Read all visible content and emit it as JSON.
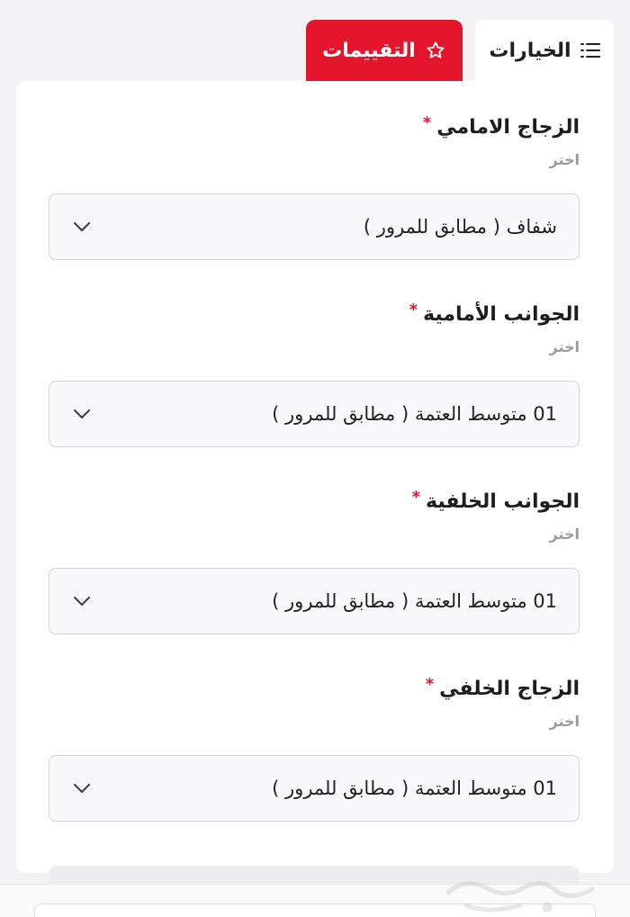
{
  "tabs": {
    "options": {
      "label": "الخيارات",
      "icon": "list-icon"
    },
    "reviews": {
      "label": "التقييمات",
      "icon": "star-icon"
    }
  },
  "fields": [
    {
      "label": "الزجاج الامامي",
      "required": "*",
      "hint": "اختر",
      "value": "شفاف ( مطابق للمرور )"
    },
    {
      "label": "الجوانب الأمامية",
      "required": "*",
      "hint": "اختر",
      "value": "01 متوسط العتمة ( مطابق للمرور )"
    },
    {
      "label": "الجوانب الخلفية",
      "required": "*",
      "hint": "اختر",
      "value": "01 متوسط العتمة ( مطابق للمرور )"
    },
    {
      "label": "الزجاج الخلفي",
      "required": "*",
      "hint": "اختر",
      "value": "01 متوسط العتمة ( مطابق للمرور )"
    }
  ],
  "colors": {
    "accent": "#e3162e",
    "background": "#f3f3f5",
    "card": "#ffffff",
    "select_border": "#d5d5d8"
  },
  "watermark": {
    "icon": "haraj-logo-watermark"
  }
}
